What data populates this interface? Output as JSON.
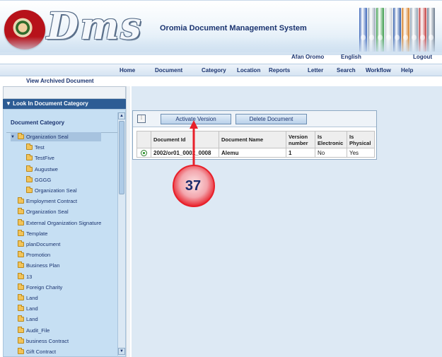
{
  "header": {
    "logo_text": "Dms",
    "system_title": "Oromia Document Management System",
    "binder_colors": [
      "#3a64b8",
      "#9aa8b8",
      "#3b9a4a",
      "#c9cfd6",
      "#2f5aa8",
      "#d47a1e",
      "#8fa0b0",
      "#c2393a",
      "#6c7c8f"
    ]
  },
  "lang_bar": {
    "lang1": "Afan Oromo",
    "lang2": "English",
    "logout": "Logout"
  },
  "nav": {
    "items": [
      "Home",
      "Document",
      "Category",
      "Location",
      "Reports",
      "Letter",
      "Search",
      "Workflow",
      "Help"
    ],
    "view_archived": "View Archived Document"
  },
  "left_panel": {
    "header": "Look In Document Category",
    "category_title": "Document Category",
    "tree": [
      {
        "label": "Organization Seal",
        "level": 0,
        "expanded": true,
        "selected": true
      },
      {
        "label": "Test",
        "level": 1
      },
      {
        "label": "TestFive",
        "level": 1
      },
      {
        "label": "Augustwe",
        "level": 1
      },
      {
        "label": "GGGG",
        "level": 1
      },
      {
        "label": "Organization Seal",
        "level": 1
      },
      {
        "label": "Employment Contract",
        "level": 0
      },
      {
        "label": "Organization Seal",
        "level": 0
      },
      {
        "label": "External Organization Signature",
        "level": 0
      },
      {
        "label": "Template",
        "level": 0
      },
      {
        "label": "planDocument",
        "level": 0
      },
      {
        "label": "Promotion",
        "level": 0
      },
      {
        "label": "Business Plan",
        "level": 0
      },
      {
        "label": "13",
        "level": 0
      },
      {
        "label": "Foreign Charity",
        "level": 0
      },
      {
        "label": "Land",
        "level": 0
      },
      {
        "label": "Land",
        "level": 0
      },
      {
        "label": "Land",
        "level": 0
      },
      {
        "label": "Audit_File",
        "level": 0
      },
      {
        "label": "business Contract",
        "level": 0
      },
      {
        "label": "Gift Contract",
        "level": 0
      }
    ]
  },
  "grid": {
    "activate_label": "Activate Version",
    "delete_label": "Delete Document",
    "columns": [
      "Document Id",
      "Document Name",
      "Version number",
      "Is Electronic",
      "Is Physical"
    ],
    "rows": [
      {
        "document_id": "2002/or01_0002_0008",
        "document_name": "Alemu",
        "version": "1",
        "electronic": "No",
        "physical": "Yes"
      }
    ]
  },
  "callout": {
    "number": "37",
    "color": "#e8202a"
  }
}
